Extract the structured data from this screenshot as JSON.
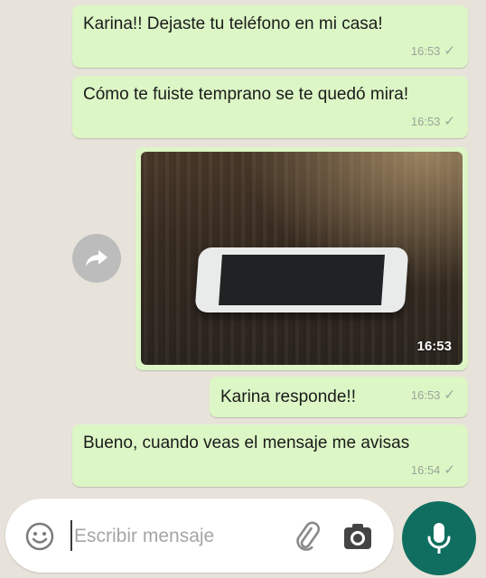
{
  "messages": [
    {
      "text": "Karina!! Dejaste tu teléfono en mi casa!",
      "time": "16:53",
      "status": "✓"
    },
    {
      "text": "Cómo te fuiste temprano se te quedó mira!",
      "time": "16:53",
      "status": "✓"
    },
    {
      "type": "image",
      "time": "16:53"
    },
    {
      "text": "Karina responde!!",
      "time": "16:53",
      "status": "✓"
    },
    {
      "text": "Bueno, cuando veas el mensaje me avisas",
      "time": "16:54",
      "status": "✓"
    }
  ],
  "input": {
    "placeholder": "Escribir mensaje"
  },
  "colors": {
    "outgoing_bubble": "#dcf6c5",
    "background": "#e8e3da",
    "mic_button": "#0f6e5f"
  },
  "icons": [
    "forward-icon",
    "emoji-icon",
    "paperclip-icon",
    "camera-icon",
    "microphone-icon"
  ]
}
